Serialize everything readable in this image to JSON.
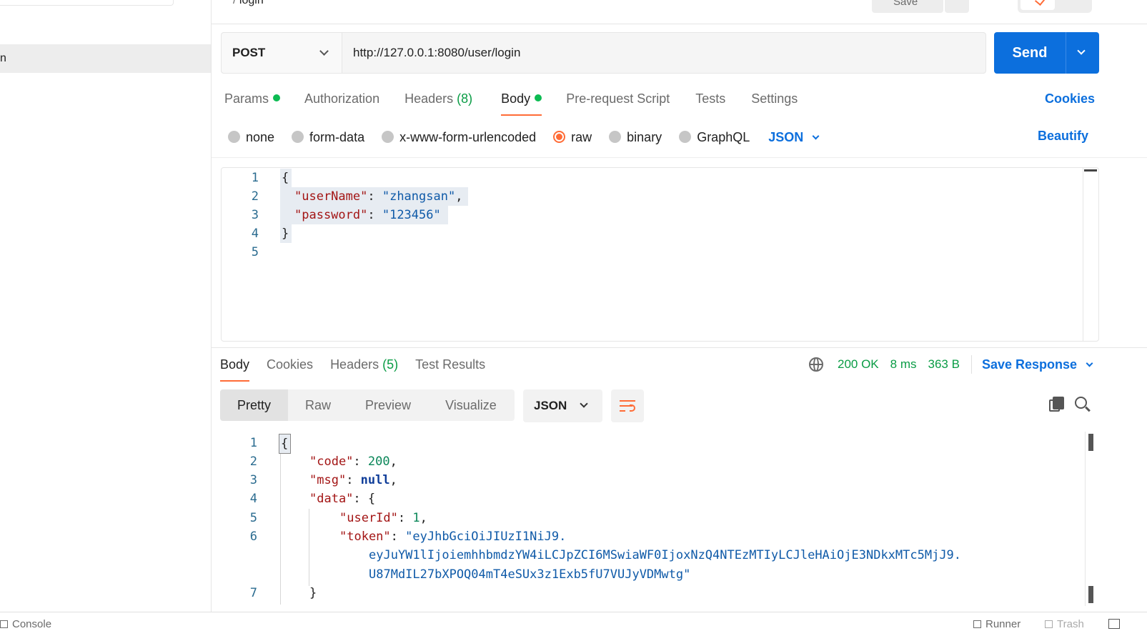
{
  "sidebar": {
    "active_item_label": "n"
  },
  "header": {
    "breadcrumb_parent": "/",
    "breadcrumb_current": "login",
    "save_label": "Save"
  },
  "request": {
    "method": "POST",
    "url": "http://127.0.0.1:8080/user/login",
    "send_label": "Send",
    "tabs": [
      {
        "label": "Params",
        "dot": true
      },
      {
        "label": "Authorization"
      },
      {
        "label": "Headers",
        "count": "(8)"
      },
      {
        "label": "Body",
        "dot": true,
        "active": true
      },
      {
        "label": "Pre-request Script"
      },
      {
        "label": "Tests"
      },
      {
        "label": "Settings"
      }
    ],
    "cookies_label": "Cookies",
    "body_types": [
      "none",
      "form-data",
      "x-www-form-urlencoded",
      "raw",
      "binary",
      "GraphQL"
    ],
    "selected_body_type": "raw",
    "body_language": "JSON",
    "beautify_label": "Beautify",
    "line_numbers": [
      "1",
      "2",
      "3",
      "4",
      "5"
    ],
    "body": {
      "open": "{",
      "k1": "\"userName\"",
      "v1": "\"zhangsan\"",
      "k2": "\"password\"",
      "v2": "\"123456\"",
      "close": "}"
    }
  },
  "response": {
    "tabs": [
      {
        "label": "Body",
        "active": true
      },
      {
        "label": "Cookies"
      },
      {
        "label": "Headers",
        "count": "(5)"
      },
      {
        "label": "Test Results"
      }
    ],
    "status": "200 OK",
    "time": "8 ms",
    "size": "363 B",
    "save_response_label": "Save Response",
    "views": [
      "Pretty",
      "Raw",
      "Preview",
      "Visualize"
    ],
    "active_view": "Pretty",
    "language": "JSON",
    "line_numbers": [
      "1",
      "2",
      "3",
      "4",
      "5",
      "6",
      "7"
    ],
    "body": {
      "open": "{",
      "code_key": "\"code\"",
      "code_val": "200",
      "msg_key": "\"msg\"",
      "msg_val": "null",
      "data_key": "\"data\"",
      "data_open": "{",
      "userid_key": "\"userId\"",
      "userid_val": "1",
      "token_key": "\"token\"",
      "token_line1": "\"eyJhbGciOiJIUzI1NiJ9.",
      "token_line2": "eyJuYW1lIjoiemhhbmdzYW4iLCJpZCI6MSwiaWF0IjoxNzQ4NTEzMTIyLCJleHAiOjE3NDkxMTc5MjJ9.",
      "token_line3": "U87MdIL27bXPOQ04mT4eSUx3z1Exb5fU7VUJyVDMwtg\"",
      "close": "}"
    }
  },
  "footer": {
    "console_label": "Console",
    "runner_label": "Runner",
    "trash_label": "Trash"
  },
  "colors": {
    "accent": "#ff6c37",
    "primary": "#0c6fdd",
    "success": "#0a9c45"
  }
}
